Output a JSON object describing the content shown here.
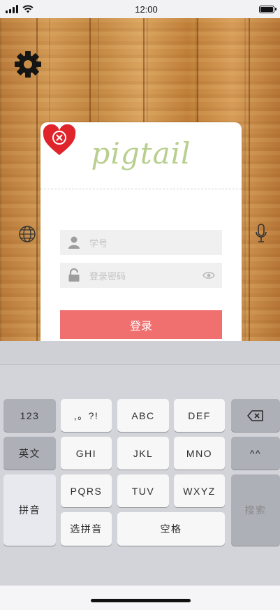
{
  "statusbar": {
    "time": "12:00"
  },
  "app": {
    "logo": "pigtail"
  },
  "login": {
    "student_id_placeholder": "学号",
    "password_placeholder": "登录密码",
    "submit_label": "登录"
  },
  "keyboard": {
    "row1": [
      "123",
      ",。?!",
      "ABC",
      "DEF"
    ],
    "row2": [
      "英文",
      "GHI",
      "JKL",
      "MNO",
      "^^"
    ],
    "row3": [
      "拼音",
      "PQRS",
      "TUV",
      "WXYZ",
      "搜索"
    ],
    "row4": [
      "选拼音",
      "空格"
    ]
  },
  "colors": {
    "accent": "#f07070",
    "logo": "#b9cf8f",
    "heart": "#e0242c"
  },
  "icons": [
    "settings-gear-icon",
    "heart-close-icon",
    "user-icon",
    "lock-icon",
    "eye-icon",
    "backspace-icon",
    "globe-icon",
    "microphone-icon"
  ]
}
